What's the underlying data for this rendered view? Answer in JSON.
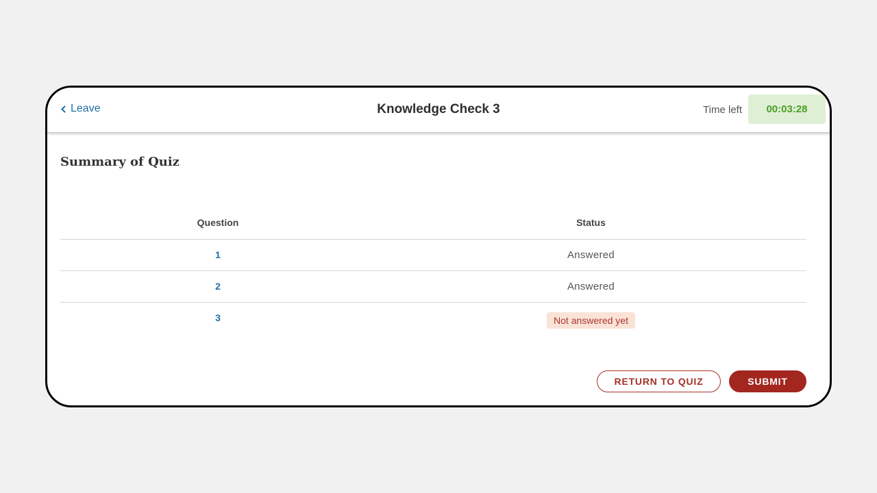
{
  "header": {
    "leave_label": "Leave",
    "title": "Knowledge Check 3",
    "time_left_label": "Time left",
    "timer_value": "00:03:28"
  },
  "summary": {
    "heading": "Summary of Quiz",
    "columns": {
      "question": "Question",
      "status": "Status"
    },
    "rows": [
      {
        "question": "1",
        "status": "Answered"
      },
      {
        "question": "2",
        "status": "Answered"
      },
      {
        "question": "3",
        "status": "Not answered yet"
      }
    ]
  },
  "actions": {
    "return_label": "RETURN TO QUIZ",
    "submit_label": "SUBMIT"
  },
  "colors": {
    "accent_blue": "#1e6ea3",
    "timer_bg": "#dfefd6",
    "timer_text": "#4a9e22",
    "danger": "#a3261f",
    "badge_bg": "#fbe2d7"
  },
  "icons": {
    "leave": "chevron-left-icon"
  }
}
